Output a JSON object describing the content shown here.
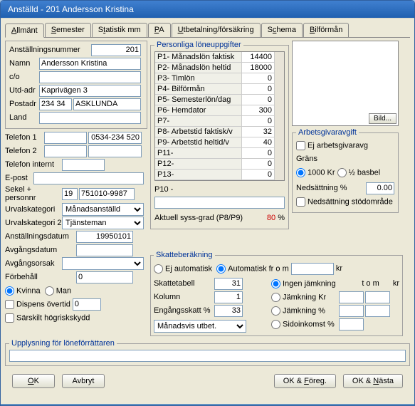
{
  "title": "Anställd - 201  Andersson Kristina",
  "tabs": [
    {
      "label": "Allmänt",
      "u": "A"
    },
    {
      "label": "Semester",
      "u": "S"
    },
    {
      "label": "Statistik mm",
      "u": "St"
    },
    {
      "label": "PA",
      "u": "P"
    },
    {
      "label": "Utbetalning/försäkring",
      "u": "U"
    },
    {
      "label": "Schema",
      "u": "Sc"
    },
    {
      "label": "Bilförmån",
      "u": "B"
    }
  ],
  "fields": {
    "anst_nr_lbl": "Anställningsnummer",
    "anst_nr": "201",
    "namn_lbl": "Namn",
    "namn": "Andersson Kristina",
    "co_lbl": "c/o",
    "co": "",
    "utdadr_lbl": "Utd-adr",
    "utdadr": "Kaprivägen 3",
    "postadr_lbl": "Postadr",
    "postnr": "234 34",
    "postort": "ASKLUNDA",
    "land_lbl": "Land",
    "land": "",
    "tel1_lbl": "Telefon 1",
    "tel1": "0534-234 520",
    "tel2_lbl": "Telefon 2",
    "tel2": "",
    "telint_lbl": "Telefon internt",
    "telint": "",
    "epost_lbl": "E-post",
    "epost": "",
    "sekel_lbl": "Sekel + personnr",
    "sekel": "19",
    "pnr": "751010-9987",
    "urval1_lbl": "Urvalskategori",
    "urval1": "Månadsanställd",
    "urval2_lbl": "Urvalskategori 2",
    "urval2": "Tjänsteman",
    "anstdat_lbl": "Anställningsdatum",
    "anstdat": "19950101",
    "avgdat_lbl": "Avgångsdatum",
    "avgdat": "",
    "avgorsak_lbl": "Avgångsorsak",
    "avgorsak": "",
    "forbehall_lbl": "Förbehåll",
    "forbehall": "0",
    "kvinna": "Kvinna",
    "man": "Man",
    "dispens": "Dispens övertid",
    "dispens_val": "0",
    "sarskilt": "Särskilt högriskskydd"
  },
  "salary": {
    "legend": "Personliga löneuppgifter",
    "rows": [
      {
        "lbl": "P1- Månadslön faktisk",
        "val": "14400"
      },
      {
        "lbl": "P2- Månadslön heltid",
        "val": "18000"
      },
      {
        "lbl": "P3- Timlön",
        "val": "0"
      },
      {
        "lbl": "P4- Bilförmån",
        "val": "0"
      },
      {
        "lbl": "P5- Semesterlön/dag",
        "val": "0"
      },
      {
        "lbl": "P6- Hemdator",
        "val": "300"
      },
      {
        "lbl": "P7-",
        "val": "0"
      },
      {
        "lbl": "P8- Arbetstid faktisk/v",
        "val": "32"
      },
      {
        "lbl": "P9- Arbetstid heltid/v",
        "val": "40"
      },
      {
        "lbl": "P11-",
        "val": "0"
      },
      {
        "lbl": "P12-",
        "val": "0"
      },
      {
        "lbl": "P13-",
        "val": "0"
      }
    ],
    "p10_lbl": "P10 -",
    "p10": "",
    "aktuell_lbl": "Aktuell syss-grad (P8/P9)",
    "aktuell_val": "80",
    "aktuell_pct": "%"
  },
  "img": {
    "btn": "Bild..."
  },
  "arbgiv": {
    "legend": "Arbetsgivaravgift",
    "ej": "Ej  arbetsgivaravg",
    "grans": "Gräns",
    "r1": "1000 Kr",
    "r2": "½ basbel",
    "neds_lbl": "Nedsättning %",
    "neds": "0.00",
    "stod": "Nedsättning stödområde"
  },
  "skatte": {
    "legend": "Skatteberäkning",
    "ej_auto": "Ej automatisk",
    "auto": "Automatisk fr o m",
    "auto_val": "",
    "kr": "kr",
    "tabell_lbl": "Skattetabell",
    "tabell": "31",
    "kolumn_lbl": "Kolumn",
    "kolumn": "1",
    "engang_lbl": "Engångsskatt %",
    "engang": "33",
    "utbet": "Månadsvis utbet.",
    "j0": "Ingen jämkning",
    "j1": "Jämkning Kr",
    "j2": "Jämkning %",
    "j3": "Sidoinkomst %",
    "tom": "t o m",
    "krh": "kr"
  },
  "upplys": {
    "legend": "Upplysning för löneförrättaren",
    "val": ""
  },
  "buttons": {
    "ok": "OK",
    "avbryt": "Avbryt",
    "foreg": "OK & Föreg.",
    "nasta": "OK & Nästa"
  }
}
